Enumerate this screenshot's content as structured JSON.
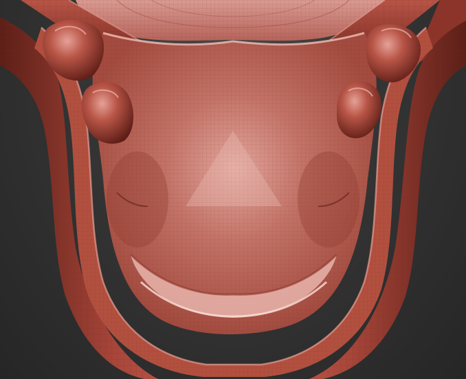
{
  "scene": {
    "subject_icon": "sculpted-mesh-icon",
    "colors": {
      "background": "#2f2f2f",
      "clay_base": "#9e3f33",
      "clay_dark": "#5c1f17",
      "clay_light": "#d9867a",
      "clay_highlight": "#f0b8ae",
      "wireframe": "#7a2b22"
    }
  }
}
